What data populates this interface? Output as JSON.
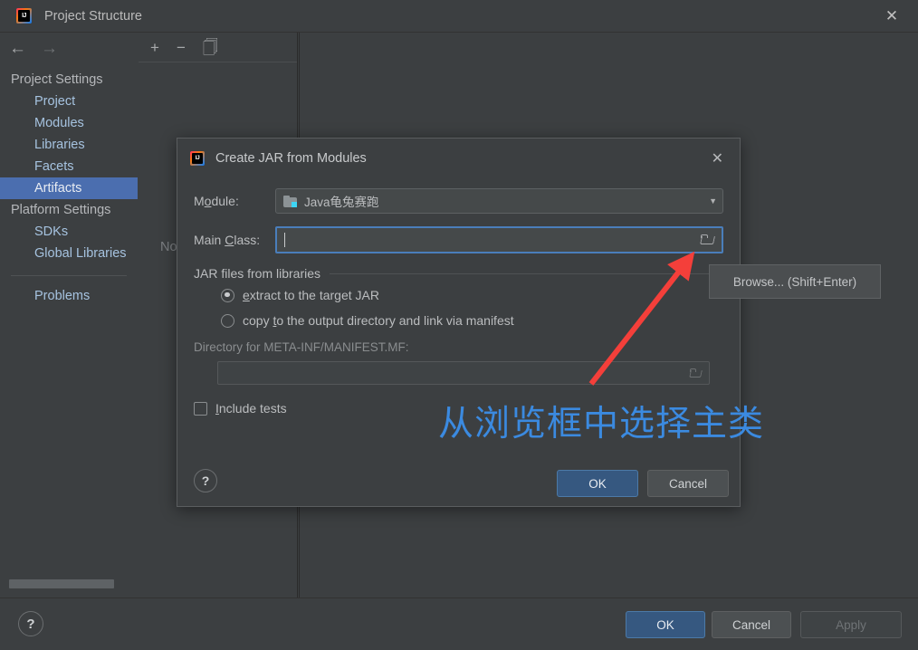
{
  "window": {
    "title": "Project Structure",
    "logo_icon": "intellij-idea-logo",
    "close_icon": "close-icon"
  },
  "nav": {
    "back_icon": "arrow-left-icon",
    "forward_icon": "arrow-right-icon",
    "items": [
      {
        "label": "Project Settings",
        "type": "group"
      },
      {
        "label": "Project",
        "type": "item"
      },
      {
        "label": "Modules",
        "type": "item"
      },
      {
        "label": "Libraries",
        "type": "item"
      },
      {
        "label": "Facets",
        "type": "item"
      },
      {
        "label": "Artifacts",
        "type": "item",
        "selected": true
      },
      {
        "label": "Platform Settings",
        "type": "group"
      },
      {
        "label": "SDKs",
        "type": "item"
      },
      {
        "label": "Global Libraries",
        "type": "item"
      },
      {
        "label": "Problems",
        "type": "item"
      }
    ]
  },
  "artifacts_pane": {
    "add_icon": "plus-icon",
    "remove_icon": "minus-icon",
    "copy_icon": "copy-icon",
    "empty_text": "No"
  },
  "bottom_bar": {
    "help_label": "?",
    "ok_label": "OK",
    "cancel_label": "Cancel",
    "apply_label": "Apply"
  },
  "dialog": {
    "logo_icon": "intellij-idea-logo",
    "title": "Create JAR from Modules",
    "close_icon": "close-icon",
    "module": {
      "label_pre": "M",
      "label_mnemonic": "o",
      "label_post": "dule:",
      "folder_icon": "module-folder-icon",
      "value": "Java龟兔赛跑",
      "dropdown_icon": "chevron-down-icon"
    },
    "main_class": {
      "label_pre": "Main ",
      "label_mnemonic": "C",
      "label_post": "lass:",
      "value": "",
      "browse_icon": "browse-folder-icon"
    },
    "libraries_group": {
      "title": "JAR files from libraries",
      "options": [
        {
          "pre": "",
          "mnemonic": "e",
          "post": "xtract to the target JAR",
          "selected": true
        },
        {
          "pre": "copy ",
          "mnemonic": "t",
          "post": "o the output directory and link via manifest",
          "selected": false
        }
      ]
    },
    "manifest_dir": {
      "label": "Directory for META-INF/MANIFEST.MF:",
      "value": "",
      "browse_icon": "browse-folder-icon",
      "enabled": false
    },
    "include_tests": {
      "pre": "",
      "mnemonic": "I",
      "post": "nclude tests",
      "checked": false
    },
    "footer": {
      "help_label": "?",
      "ok_label": "OK",
      "cancel_label": "Cancel"
    }
  },
  "annotations": {
    "tooltip_text": "Browse... (Shift+Enter)",
    "chinese_note": "从浏览框中选择主类",
    "arrow_color": "#f43f3a",
    "note_color": "#3b8ae0"
  },
  "colors": {
    "window_bg": "#3c3f41",
    "selection_blue": "#4b6eaf",
    "primary_button": "#365880",
    "focus_border": "#4a7ebb"
  }
}
